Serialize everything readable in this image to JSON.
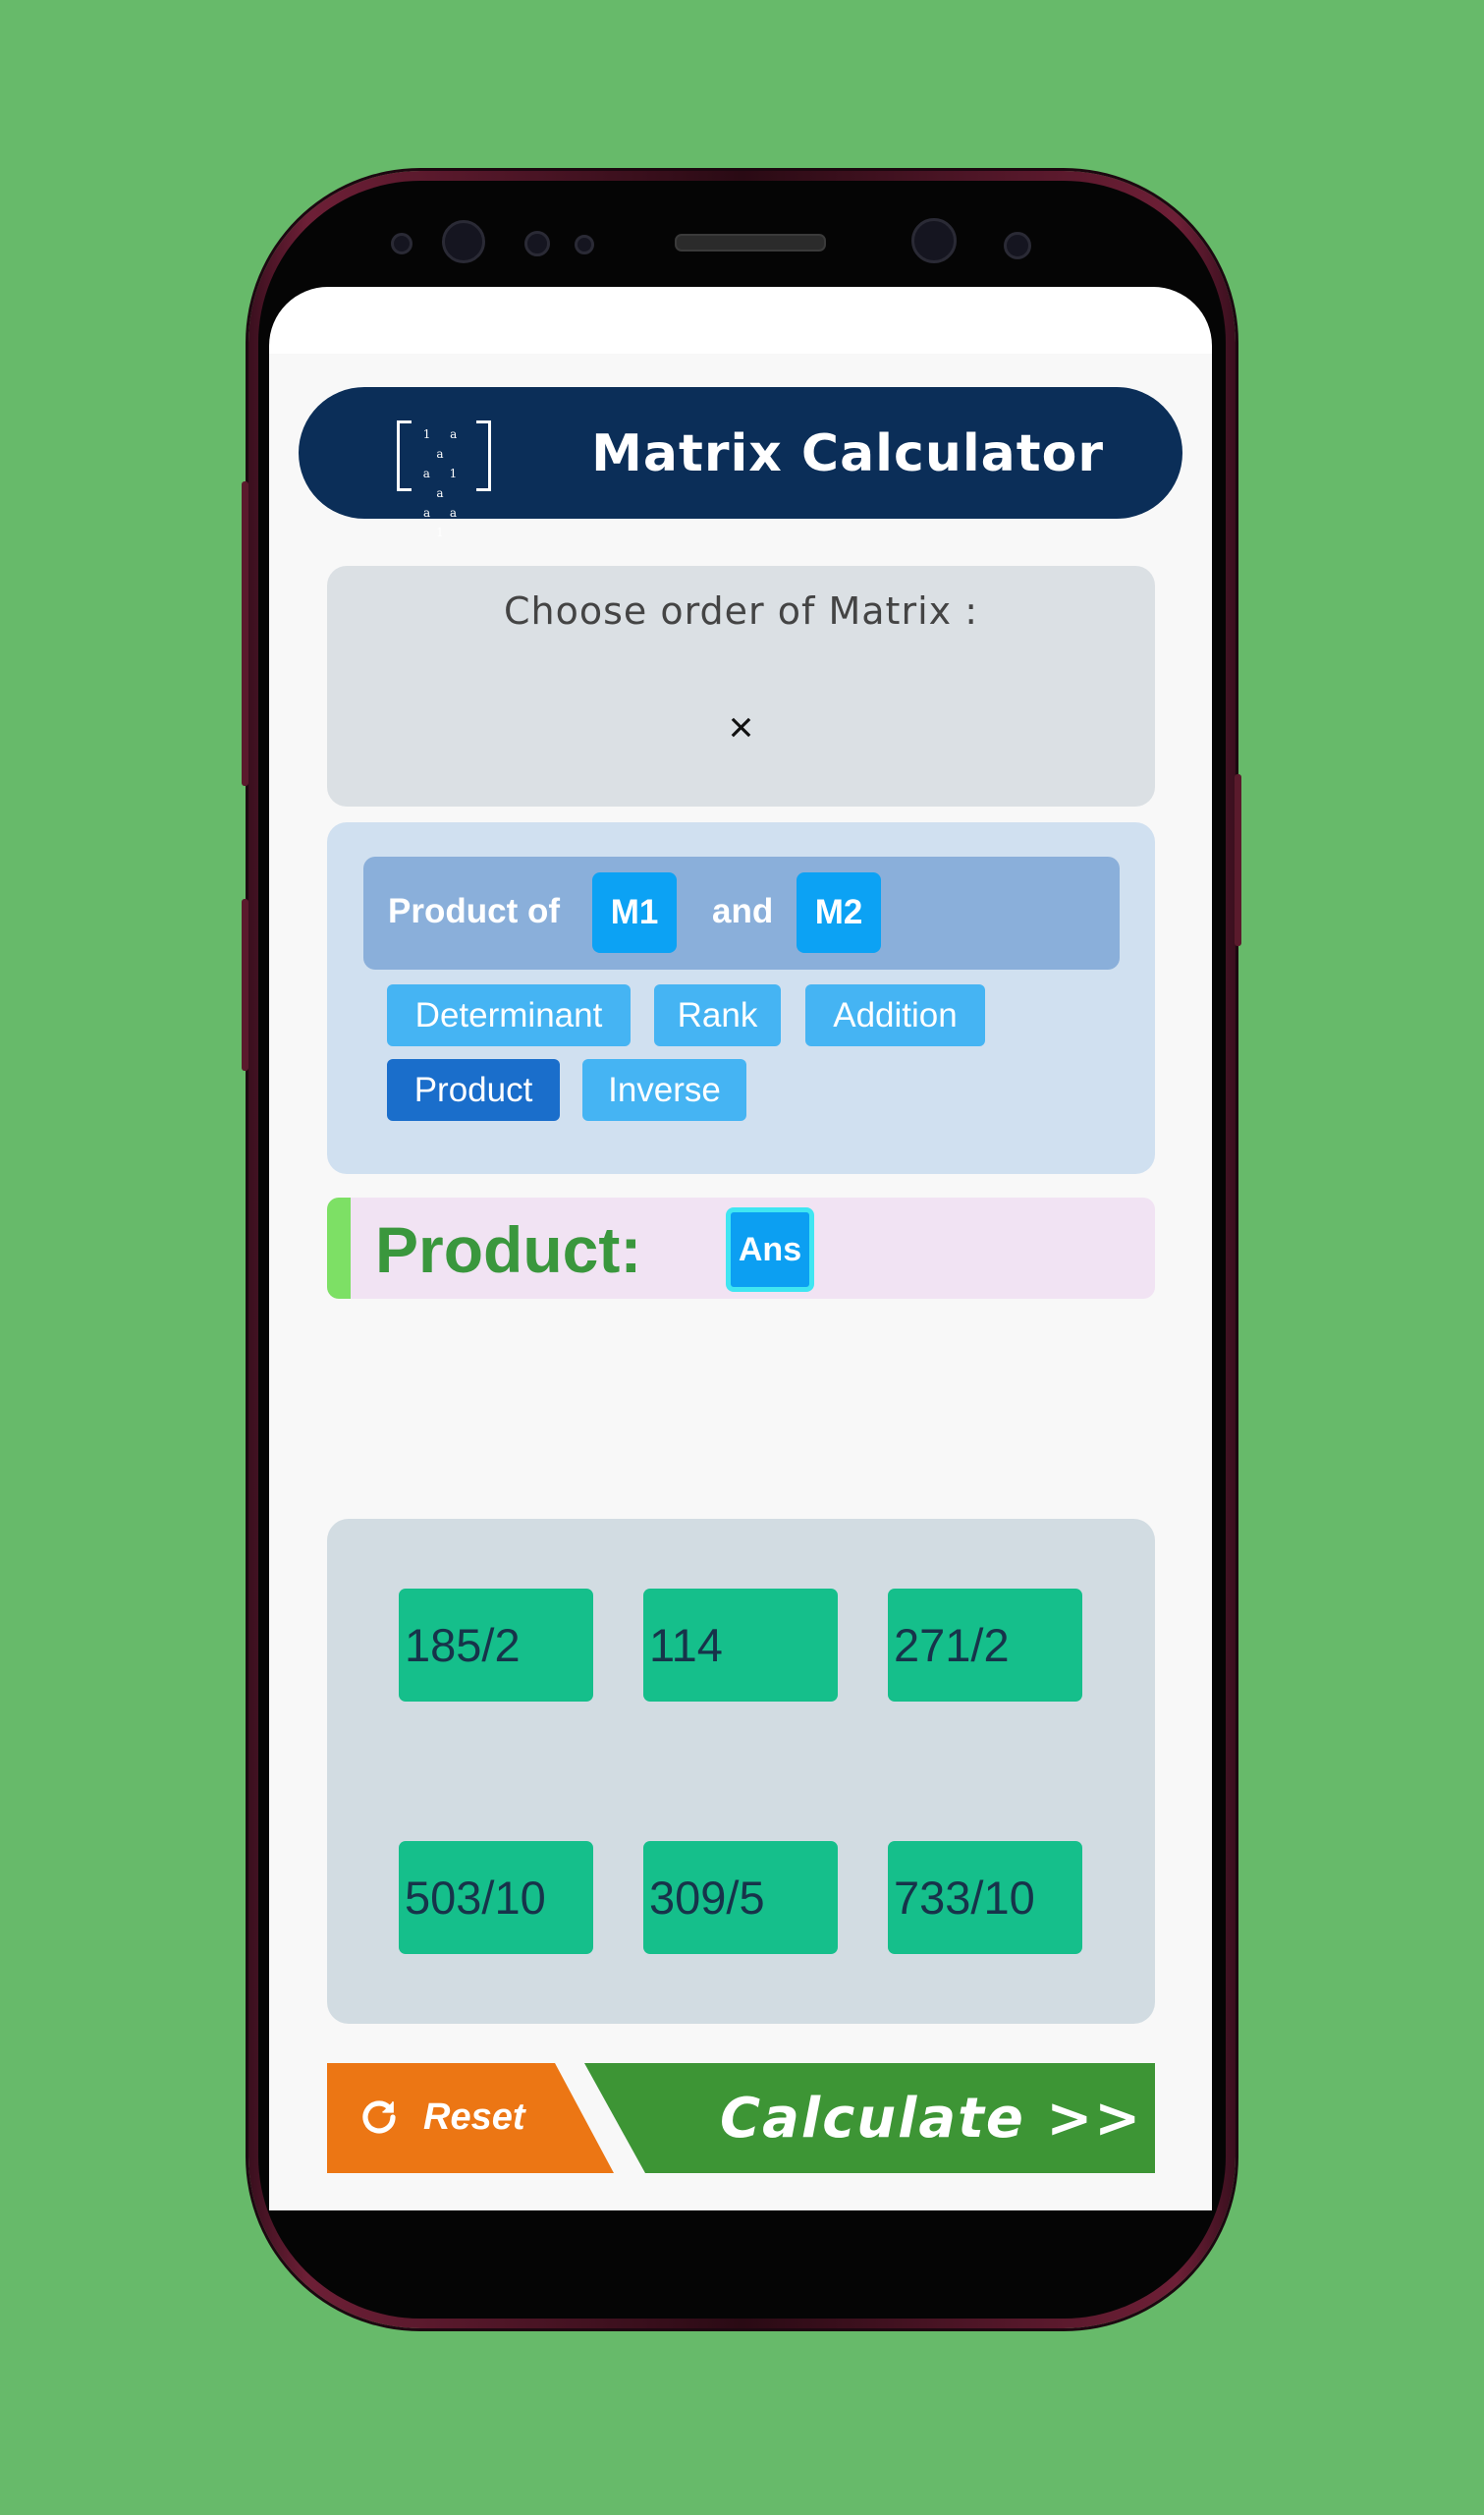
{
  "header": {
    "title": "Matrix Calculator"
  },
  "order": {
    "label": "Choose order of Matrix :",
    "separator": "×"
  },
  "operations": {
    "product_of_label": "Product of",
    "m1_label": "M1",
    "and_label": "and",
    "m2_label": "M2",
    "chips": [
      "Determinant",
      "Rank",
      "Addition",
      "Product",
      "Inverse"
    ],
    "active_chip": "Product"
  },
  "result": {
    "label": "Product:",
    "ans_label": "Ans"
  },
  "matrix": {
    "cells": [
      "185/2",
      "114",
      "271/2",
      "503/10",
      "309/5",
      "733/10"
    ]
  },
  "actions": {
    "reset_label": "Reset",
    "calculate_label": "Calculate  >>"
  },
  "colors": {
    "background": "#67ba6a",
    "header": "#0b2e58",
    "chip": "#45b4f3",
    "chip_active": "#1a6ecb",
    "cell": "#15bf8b",
    "reset": "#ec7614",
    "calculate": "#3d9535",
    "result_text": "#3a973d"
  }
}
